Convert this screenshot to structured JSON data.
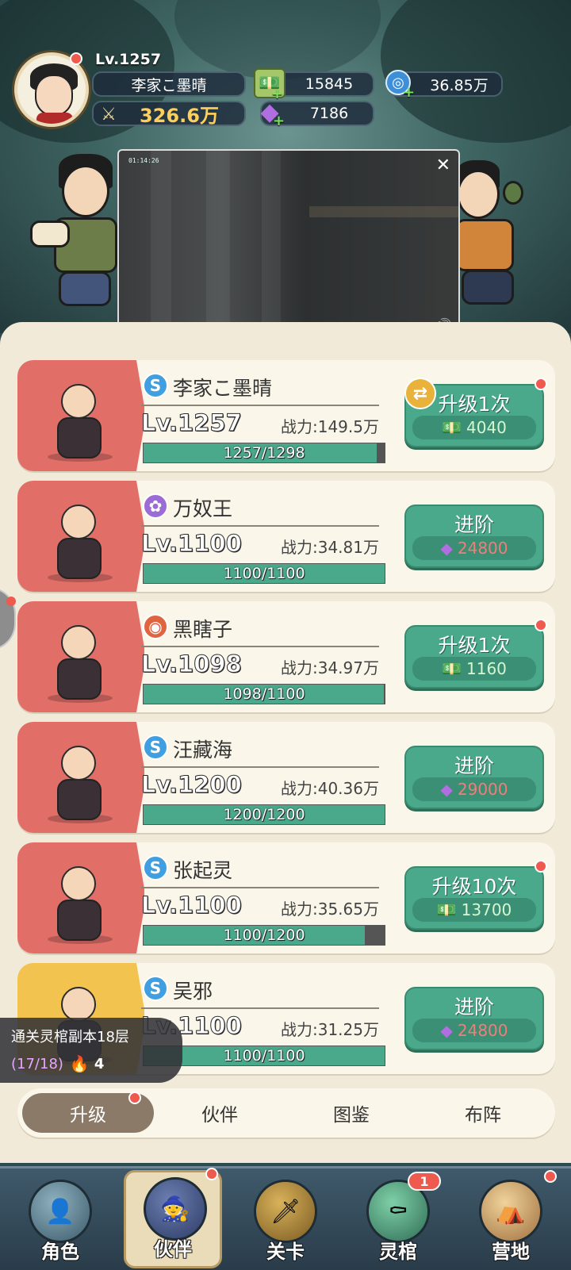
{
  "player": {
    "level": "Lv.1257",
    "name": "李家こ墨晴",
    "power": "326.6万",
    "money": "15845",
    "orb": "36.85万",
    "gems": "7186"
  },
  "heroes": [
    {
      "faction_symbol": "S",
      "faction_color": "#3f9fe0",
      "name": "李家こ墨晴",
      "level": "Lv.1257",
      "power": "战力:149.5万",
      "progress_text": "1257/1298",
      "progress": 0.968,
      "action": "升级1次",
      "cost": "4040",
      "cost_type": "money",
      "swap": true,
      "red_dot": true,
      "portrait_color": "red"
    },
    {
      "faction_symbol": "✿",
      "faction_color": "#9b6cd6",
      "name": "万奴王",
      "level": "Lv.1100",
      "power": "战力:34.81万",
      "progress_text": "1100/1100",
      "progress": 1.0,
      "action": "进阶",
      "cost": "24800",
      "cost_type": "gem",
      "swap": false,
      "red_dot": false,
      "portrait_color": "red"
    },
    {
      "faction_symbol": "◉",
      "faction_color": "#e0643f",
      "name": "黑瞎子",
      "level": "Lv.1098",
      "power": "战力:34.97万",
      "progress_text": "1098/1100",
      "progress": 0.998,
      "action": "升级1次",
      "cost": "1160",
      "cost_type": "money",
      "swap": false,
      "red_dot": true,
      "portrait_color": "red"
    },
    {
      "faction_symbol": "S",
      "faction_color": "#3f9fe0",
      "name": "汪藏海",
      "level": "Lv.1200",
      "power": "战力:40.36万",
      "progress_text": "1200/1200",
      "progress": 1.0,
      "action": "进阶",
      "cost": "29000",
      "cost_type": "gem",
      "swap": false,
      "red_dot": false,
      "portrait_color": "red"
    },
    {
      "faction_symbol": "S",
      "faction_color": "#3f9fe0",
      "name": "张起灵",
      "level": "Lv.1100",
      "power": "战力:35.65万",
      "progress_text": "1100/1200",
      "progress": 0.917,
      "action": "升级10次",
      "cost": "13700",
      "cost_type": "money",
      "swap": false,
      "red_dot": true,
      "portrait_color": "red"
    },
    {
      "faction_symbol": "S",
      "faction_color": "#3f9fe0",
      "name": "吴邪",
      "level": "Lv.1100",
      "power": "战力:31.25万",
      "progress_text": "1100/1100",
      "progress": 1.0,
      "action": "进阶",
      "cost": "24800",
      "cost_type": "gem",
      "swap": false,
      "red_dot": false,
      "portrait_color": "gold"
    }
  ],
  "video": {
    "time": "01:14:26"
  },
  "quest": {
    "title": "通关灵棺副本18层",
    "progress": "(17/18)",
    "count": "4"
  },
  "tabs": [
    "升级",
    "伙伴",
    "图鉴",
    "布阵"
  ],
  "nav": [
    {
      "label": "角色",
      "icon": "👤"
    },
    {
      "label": "伙伴",
      "icon": "🧙"
    },
    {
      "label": "关卡",
      "icon": "🗡"
    },
    {
      "label": "灵棺",
      "icon": "⚰",
      "badge": "1"
    },
    {
      "label": "营地",
      "icon": "⛺"
    }
  ]
}
